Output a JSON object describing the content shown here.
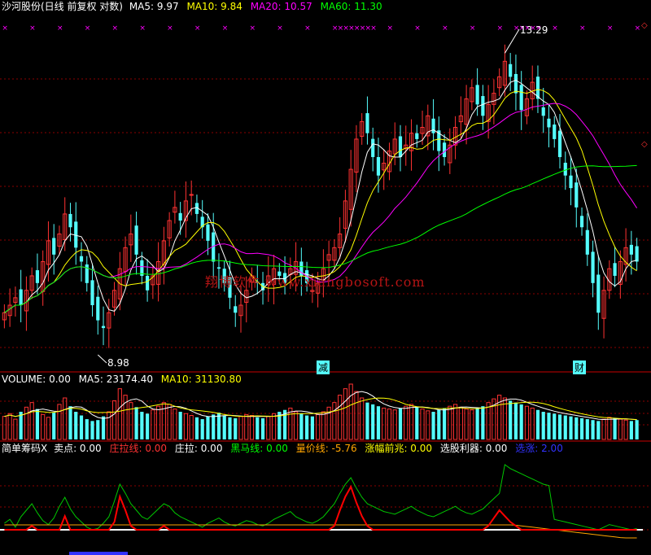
{
  "colors": {
    "background": "#000000",
    "up": "#ff3232",
    "down": "#54fcfc",
    "ma5": "#ffffff",
    "ma10": "#ffff00",
    "ma20": "#ff00ff",
    "ma60": "#00ff00",
    "grid": "#8b0000",
    "cross": "#ff00ff",
    "watermark": "#b41414"
  },
  "header": {
    "title": "沙河股份(日线 前复权 对数)",
    "ma5": "MA5: 9.97",
    "ma10": "MA10: 9.84",
    "ma20": "MA20: 10.57",
    "ma60": "MA60: 11.30"
  },
  "volume_header": {
    "title": "VOLUME: 0.00",
    "ma5": "MA5: 23174.40",
    "ma10": "MA10: 31130.80"
  },
  "indicator_header": {
    "title": "简单筹码X",
    "sell": "卖点: 0.00",
    "zhuang_line": "庄拉线: 0.00",
    "zhuang_la": "庄拉: 0.00",
    "heima": "黑马线: 0.00",
    "liangjia": "量价线: -5.76",
    "zhangfu": "涨幅前兆: 0.00",
    "xuangu": "选股利器: 0.00",
    "xuanzhang": "选涨: 2.00"
  },
  "watermark": "翔博软件 www.xiangbosoft.com",
  "markers": {
    "high": "13.29",
    "low": "8.98",
    "event1": "减",
    "event2": "财"
  },
  "chart_data": {
    "type": "candlestick",
    "scale": "log",
    "ylim": [
      8.6,
      14.2
    ],
    "high_marker": 13.29,
    "low_marker": 8.98,
    "close_series": [
      9.3,
      9.4,
      9.5,
      9.4,
      9.6,
      9.8,
      9.7,
      10.0,
      10.3,
      10.1,
      10.4,
      10.7,
      10.5,
      10.2,
      10.0,
      9.7,
      9.4,
      9.2,
      9.1,
      9.3,
      9.6,
      9.9,
      10.2,
      10.4,
      10.1,
      9.8,
      9.6,
      9.8,
      10.0,
      10.3,
      10.6,
      10.8,
      10.6,
      10.9,
      11.0,
      10.7,
      10.5,
      10.3,
      10.0,
      9.9,
      9.7,
      9.5,
      9.3,
      9.4,
      9.6,
      9.8,
      9.7,
      9.6,
      9.8,
      9.9,
      9.8,
      9.7,
      9.9,
      10.0,
      9.8,
      9.7,
      9.6,
      9.7,
      9.9,
      10.1,
      10.2,
      10.4,
      10.9,
      11.4,
      11.9,
      12.2,
      12.0,
      11.6,
      11.3,
      11.5,
      11.7,
      11.9,
      11.6,
      11.8,
      12.0,
      11.9,
      12.1,
      12.3,
      12.0,
      11.7,
      11.6,
      11.8,
      12.1,
      12.3,
      12.6,
      12.8,
      12.5,
      12.3,
      12.5,
      12.7,
      13.0,
      13.29,
      13.0,
      12.7,
      12.4,
      12.6,
      12.9,
      12.6,
      12.3,
      12.1,
      11.9,
      11.6,
      11.3,
      11.1,
      10.8,
      10.5,
      10.1,
      9.7,
      9.3,
      9.6,
      9.9,
      9.8,
      10.0,
      10.2,
      10.1,
      10.0
    ]
  },
  "volume_data": [
    25,
    28,
    22,
    30,
    35,
    40,
    33,
    27,
    24,
    29,
    38,
    45,
    36,
    30,
    26,
    22,
    20,
    21,
    25,
    30,
    42,
    55,
    48,
    40,
    35,
    30,
    28,
    32,
    36,
    40,
    38,
    33,
    30,
    28,
    26,
    24,
    22,
    25,
    27,
    29,
    26,
    24,
    23,
    25,
    27,
    26,
    24,
    23,
    25,
    28,
    30,
    32,
    34,
    30,
    28,
    26,
    25,
    27,
    30,
    35,
    40,
    48,
    55,
    60,
    52,
    45,
    40,
    38,
    36,
    34,
    33,
    32,
    34,
    36,
    38,
    35,
    33,
    31,
    30,
    32,
    34,
    36,
    38,
    35,
    33,
    32,
    34,
    36,
    40,
    44,
    48,
    45,
    42,
    40,
    38,
    36,
    34,
    32,
    30,
    29,
    28,
    27,
    26,
    25,
    24,
    23,
    22,
    21,
    20,
    22,
    24,
    23,
    22,
    21,
    20,
    21
  ]
}
